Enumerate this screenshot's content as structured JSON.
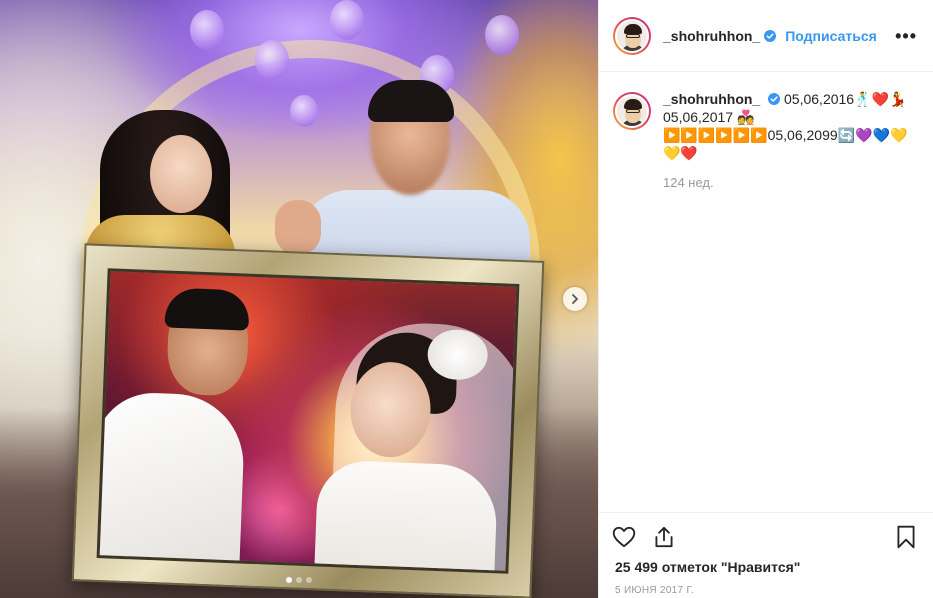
{
  "post": {
    "username": "_shohruhhon_",
    "follow_label": "Подписаться",
    "more_label": "•••",
    "caption_username": "_shohruhhon_",
    "caption_text": "05,06,2016🕺❤️💃 05,06,2017 💑 ▶️▶️▶️▶️▶️▶️05,06,2099🔄💜💙💛💛❤️",
    "caption_time": "124 нед.",
    "likes": "25 499 отметок \"Нравится\"",
    "date": "5 июня 2017 г."
  },
  "media": {
    "slides": 3,
    "active_slide": 1
  },
  "icons": {
    "verified": "verified-badge-icon",
    "like": "heart-icon",
    "share": "share-icon",
    "save": "bookmark-icon",
    "next": "chevron-right-icon",
    "more": "more-dots-icon"
  },
  "colors": {
    "link": "#3897f0",
    "text": "#262626",
    "muted": "#999999",
    "border": "#efefef"
  }
}
